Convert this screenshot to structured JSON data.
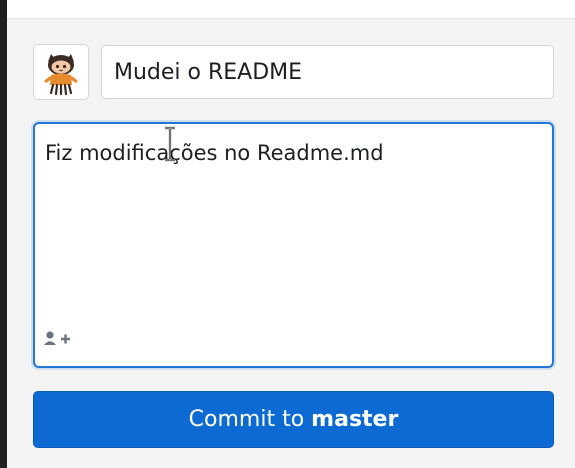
{
  "commit": {
    "summary_value": "Mudei o README",
    "description_value": "Fiz modificações no Readme.md",
    "button_label": "Commit to",
    "branch": "master"
  },
  "colors": {
    "accent": "#0e6ad3",
    "focus_border": "#1f78d1",
    "panel_bg": "#f4f4f5"
  },
  "icons": {
    "avatar": "octocat-avatar",
    "coauthor": "add-coauthor-icon",
    "cursor": "text-cursor-icon"
  }
}
